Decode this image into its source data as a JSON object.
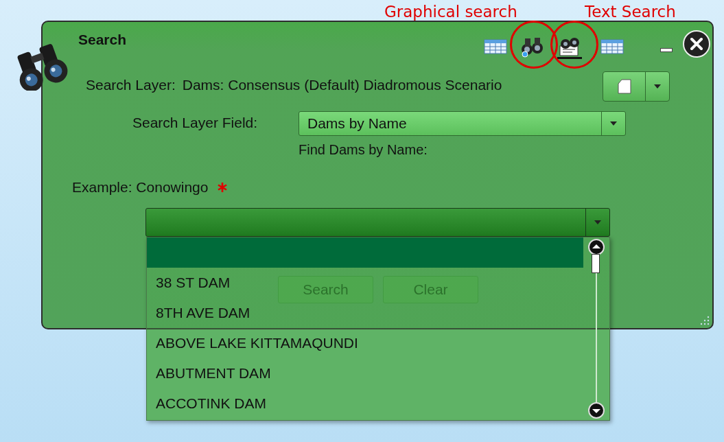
{
  "annotations": [
    {
      "label": "Graphical search"
    },
    {
      "label": "Text Search"
    }
  ],
  "panel": {
    "title": "Search",
    "tools": [
      {
        "kind": "table",
        "selected": false
      },
      {
        "kind": "graphical",
        "selected": false
      },
      {
        "kind": "text",
        "selected": true
      },
      {
        "kind": "table",
        "selected": false
      }
    ],
    "search_layer": {
      "label": "Search Layer:",
      "value": "Dams: Consensus (Default) Diadromous Scenario"
    },
    "search_layer_field": {
      "label": "Search Layer Field:",
      "value": "Dams by Name"
    },
    "find_label": "Find Dams by Name:",
    "example": {
      "label": "Example: Conowingo",
      "required": true
    },
    "buttons": [
      {
        "label": "Search",
        "disabled": true
      },
      {
        "label": "Clear",
        "disabled": true
      }
    ]
  },
  "dropdown": {
    "blank_row_selected": true,
    "items": [
      {
        "label": "38 ST DAM"
      },
      {
        "label": "8TH AVE DAM"
      },
      {
        "label": "ABOVE LAKE KITTAMAQUNDI"
      },
      {
        "label": "ABUTMENT DAM"
      },
      {
        "label": "ACCOTINK DAM"
      }
    ]
  }
}
